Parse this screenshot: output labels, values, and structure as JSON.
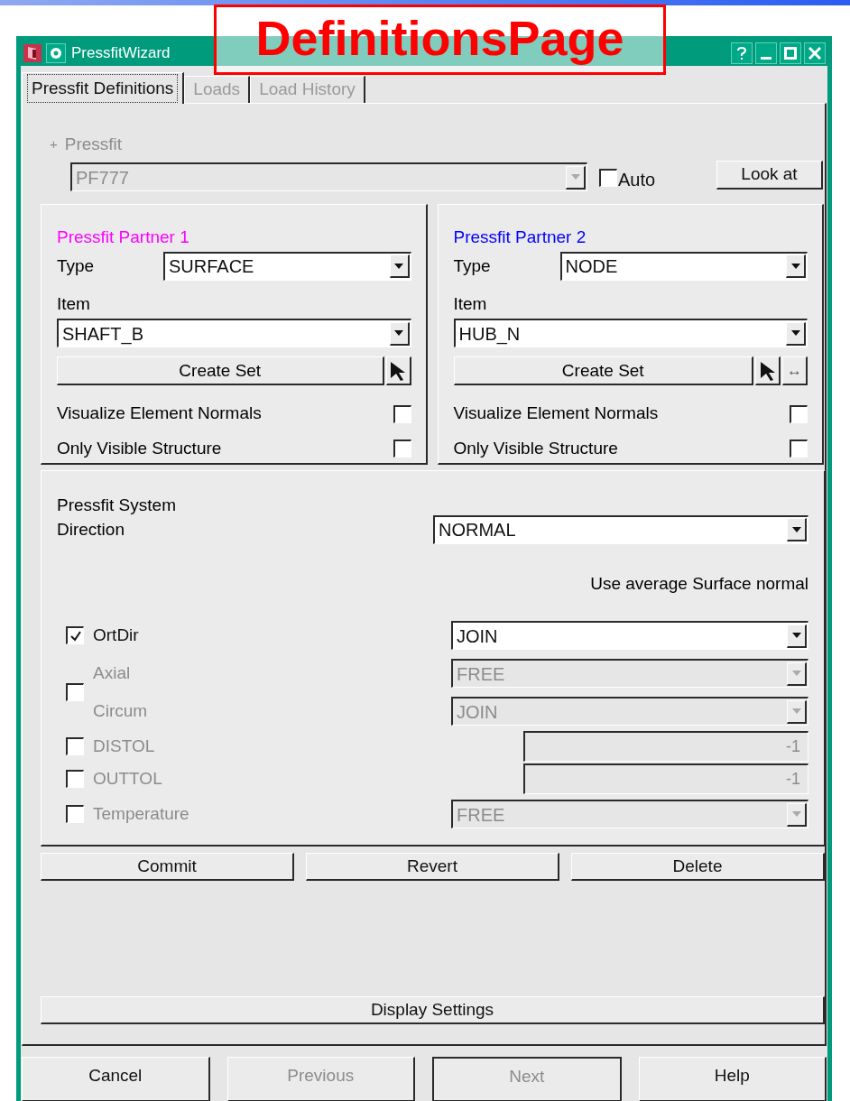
{
  "annotation": {
    "label": "DefinitionsPage"
  },
  "window": {
    "title": "PressfitWizard"
  },
  "tabs": [
    {
      "label": "Pressfit Definitions",
      "selected": true,
      "disabled": false
    },
    {
      "label": "Loads",
      "selected": false,
      "disabled": true
    },
    {
      "label": "Load History",
      "selected": false,
      "disabled": true
    }
  ],
  "pressfit": {
    "expander": "+",
    "label": "Pressfit",
    "value": "PF777",
    "disabled": true,
    "auto": {
      "label": "Auto",
      "checked": false
    },
    "look_at": "Look at"
  },
  "partners": [
    {
      "title": "Pressfit Partner 1",
      "color": "#ff00ff",
      "type_label": "Type",
      "type_value": "SURFACE",
      "item_label": "Item",
      "item_value": "SHAFT_B",
      "create_set": "Create Set",
      "tools": [
        {
          "kind": "pick"
        }
      ],
      "options": [
        {
          "label": "Visualize Element Normals",
          "checked": false
        },
        {
          "label": "Only Visible Structure",
          "checked": false
        }
      ]
    },
    {
      "title": "Pressfit Partner 2",
      "color": "#0000ff",
      "type_label": "Type",
      "type_value": "NODE",
      "item_label": "Item",
      "item_value": "HUB_N",
      "create_set": "Create Set",
      "tools": [
        {
          "kind": "pick"
        },
        {
          "kind": "swap",
          "label": "↔"
        }
      ],
      "options": [
        {
          "label": "Visualize Element Normals",
          "checked": false
        },
        {
          "label": "Only Visible Structure",
          "checked": false
        }
      ]
    }
  ],
  "system": {
    "title": "Pressfit System",
    "direction_label": "Direction",
    "direction_value": "NORMAL",
    "note": "Use average Surface normal",
    "rows": [
      {
        "kind": "select",
        "label": "OrtDir",
        "checked": true,
        "disabled": false,
        "value": "JOIN"
      },
      {
        "kind": "pair",
        "checked": false,
        "disabled": true,
        "items": [
          {
            "label": "Axial",
            "value": "FREE"
          },
          {
            "label": "Circum",
            "value": "JOIN"
          }
        ]
      },
      {
        "kind": "number",
        "label": "DISTOL",
        "checked": false,
        "disabled": true,
        "value": "-1"
      },
      {
        "kind": "number",
        "label": "OUTTOL",
        "checked": false,
        "disabled": true,
        "value": "-1"
      },
      {
        "kind": "select",
        "label": "Temperature",
        "checked": false,
        "disabled": true,
        "value": "FREE"
      }
    ]
  },
  "actions": [
    "Commit",
    "Revert",
    "Delete"
  ],
  "display_settings": "Display Settings",
  "footer": [
    {
      "label": "Cancel",
      "disabled": false,
      "default": false
    },
    {
      "label": "Previous",
      "disabled": true,
      "default": false
    },
    {
      "label": "Next",
      "disabled": true,
      "default": true
    },
    {
      "label": "Help",
      "disabled": false,
      "default": false
    }
  ]
}
